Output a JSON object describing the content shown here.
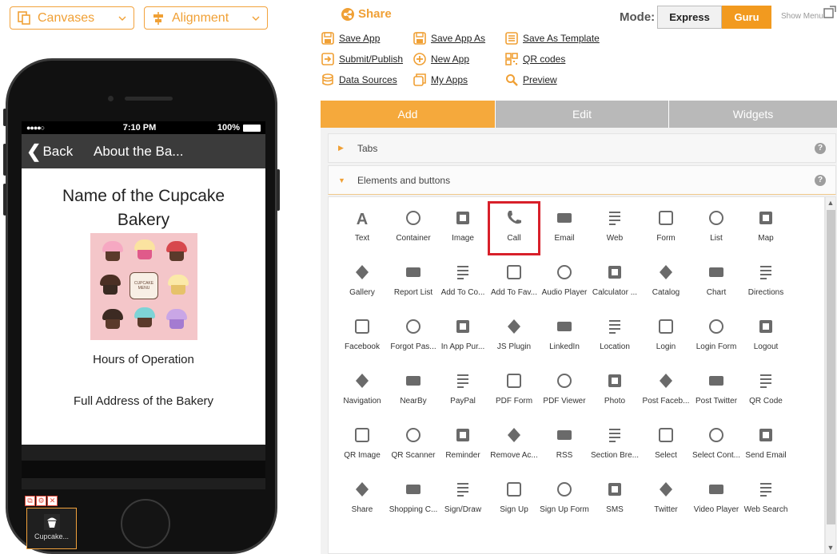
{
  "toolbar": {
    "canvases_label": "Canvases",
    "alignment_label": "Alignment"
  },
  "phone": {
    "status": {
      "signal": "●●●●○",
      "time": "7:10 PM",
      "battery": "100%"
    },
    "nav": {
      "back_label": "Back",
      "title": "About the Ba..."
    },
    "content": {
      "name_line1": "Name of the Cupcake",
      "name_line2": "Bakery",
      "menu_card_text": "CUPCAKE MENU",
      "hours": "Hours of Operation",
      "address": "Full Address of the Bakery"
    },
    "tab_item_label": "Cupcake..."
  },
  "header": {
    "share_label": "Share",
    "mode_label": "Mode:",
    "mode_express": "Express",
    "mode_guru": "Guru",
    "show_menu": "Show Menu"
  },
  "actions": {
    "save_app": "Save App",
    "save_app_as": "Save App As",
    "save_as_template": "Save As Template",
    "submit_publish": "Submit/Publish",
    "new_app": "New App",
    "qr_codes": "QR codes",
    "data_sources": "Data Sources",
    "my_apps": "My Apps",
    "preview": "Preview"
  },
  "tabs": {
    "add": "Add",
    "edit": "Edit",
    "widgets": "Widgets"
  },
  "accordion": {
    "tabs": "Tabs",
    "elements": "Elements and buttons",
    "help": "?"
  },
  "widgets": [
    [
      "Text",
      "Container",
      "Image",
      "Call",
      "Email",
      "Web",
      "Form",
      "List",
      "Map"
    ],
    [
      "Gallery",
      "Report List",
      "Add To Co...",
      "Add To Fav...",
      "Audio Player",
      "Calculator ...",
      "Catalog",
      "Chart",
      "Directions"
    ],
    [
      "Facebook",
      "Forgot Pas...",
      "In App Pur...",
      "JS Plugin",
      "LinkedIn",
      "Location",
      "Login",
      "Login Form",
      "Logout"
    ],
    [
      "Navigation",
      "NearBy",
      "PayPal",
      "PDF Form",
      "PDF Viewer",
      "Photo",
      "Post Faceb...",
      "Post Twitter",
      "QR Code"
    ],
    [
      "QR Image",
      "QR Scanner",
      "Reminder",
      "Remove Ac...",
      "RSS",
      "Section Bre...",
      "Select",
      "Select Cont...",
      "Send Email"
    ],
    [
      "Share",
      "Shopping C...",
      "Sign/Draw",
      "Sign Up",
      "Sign Up Form",
      "SMS",
      "Twitter",
      "Video Player",
      "Web Search"
    ]
  ],
  "selected_widget": "Call",
  "colors": {
    "accent": "#f0a035",
    "selection": "#d8202a",
    "icon_gray": "#6a6a6a"
  }
}
